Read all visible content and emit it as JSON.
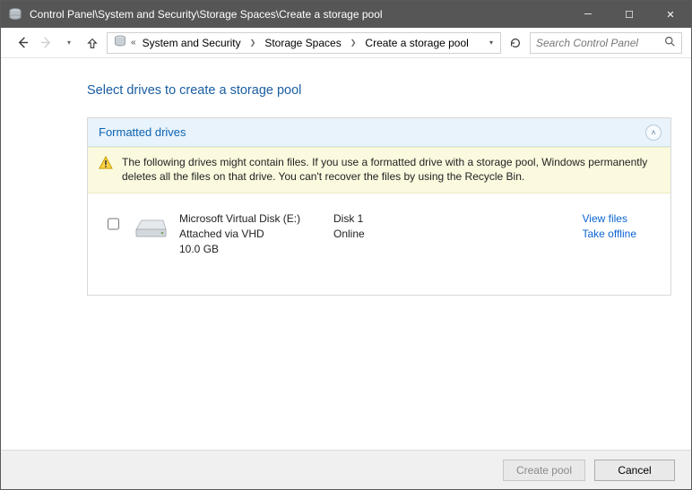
{
  "window": {
    "title": "Control Panel\\System and Security\\Storage Spaces\\Create a storage pool"
  },
  "breadcrumb": {
    "items": [
      "System and Security",
      "Storage Spaces",
      "Create a storage pool"
    ]
  },
  "search": {
    "placeholder": "Search Control Panel"
  },
  "page": {
    "heading": "Select drives to create a storage pool"
  },
  "panel": {
    "title": "Formatted drives",
    "warning": "The following drives might contain files. If you use a formatted drive with a storage pool, Windows permanently deletes all the files on that drive. You can't recover the files by using the Recycle Bin."
  },
  "drives": [
    {
      "checked": false,
      "name": "Microsoft Virtual Disk (E:)",
      "attach": "Attached via VHD",
      "size": "10.0 GB",
      "disk": "Disk 1",
      "status": "Online",
      "view_label": "View files",
      "offline_label": "Take offline"
    }
  ],
  "footer": {
    "create_label": "Create pool",
    "cancel_label": "Cancel"
  }
}
